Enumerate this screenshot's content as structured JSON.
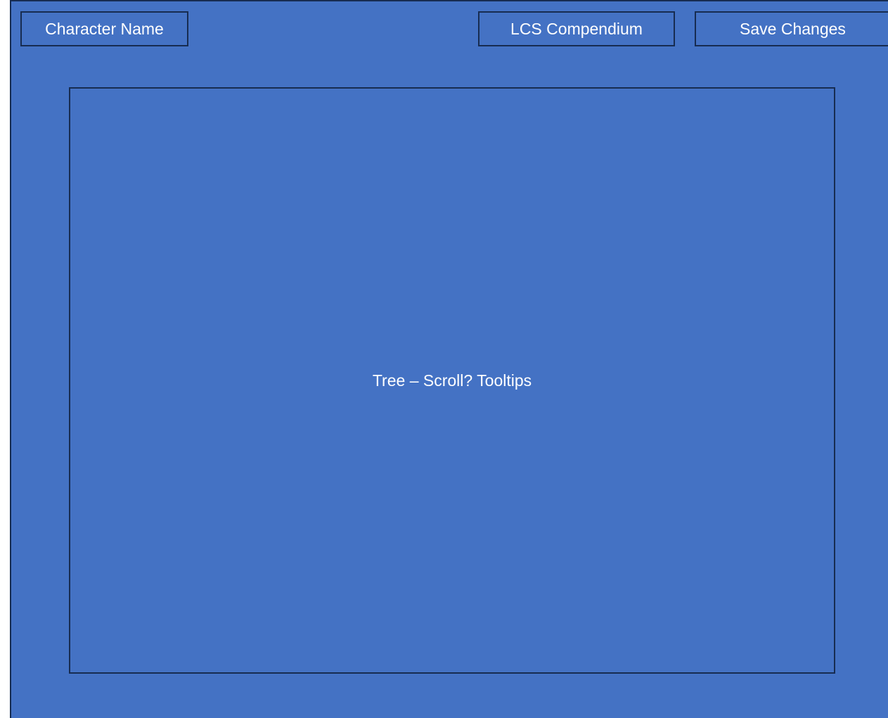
{
  "header": {
    "character_name_label": "Character Name",
    "compendium_label": "LCS Compendium",
    "save_label": "Save Changes"
  },
  "main": {
    "tree_placeholder": "Tree – Scroll? Tooltips"
  },
  "colors": {
    "background": "#4472c4",
    "border": "#172c51",
    "text": "#ffffff"
  }
}
